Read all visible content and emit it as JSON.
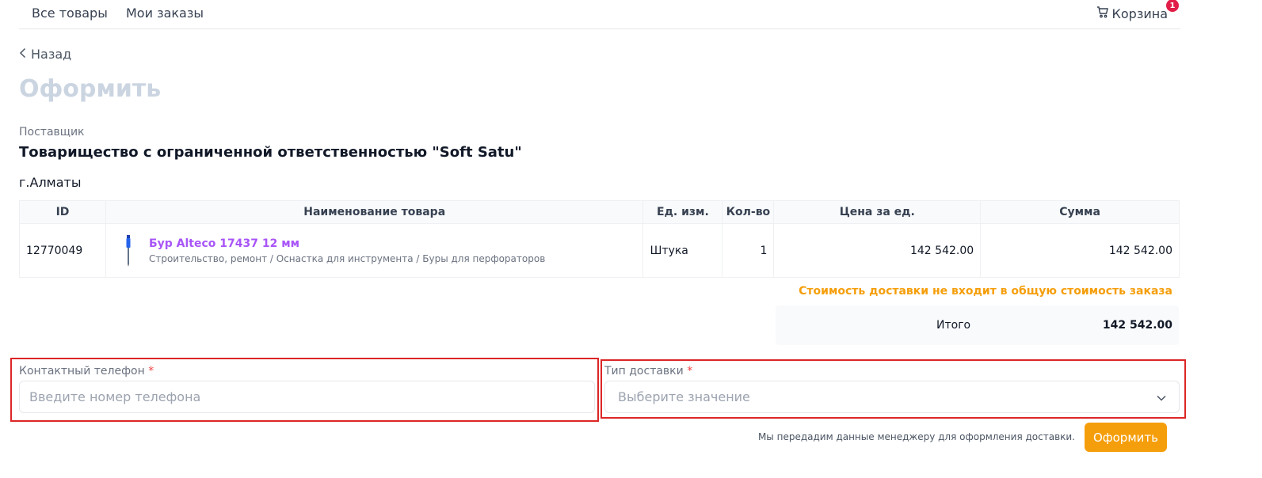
{
  "nav": {
    "all_products": "Все товары",
    "my_orders": "Мои заказы",
    "cart_label": "Корзина",
    "cart_count": "1"
  },
  "back_label": "Назад",
  "page_title": "Оформить",
  "supplier": {
    "label": "Поставщик",
    "name": "Товарищество с ограниченной ответственностью \"Soft Satu\"",
    "city": "г.Алматы"
  },
  "table": {
    "headers": {
      "id": "ID",
      "name": "Наименование товара",
      "unit": "Ед. изм.",
      "qty": "Кол-во",
      "price": "Цена за ед.",
      "sum": "Сумма"
    },
    "rows": [
      {
        "id": "12770049",
        "title": "Бур Alteco 17437 12 мм",
        "path": "Строительство, ремонт / Оснастка для инструмента / Буры для перфораторов",
        "unit": "Штука",
        "qty": "1",
        "price": "142 542.00",
        "sum": "142 542.00"
      }
    ]
  },
  "delivery_note": "Стоимость доставки не входит в общую стоимость заказа",
  "total": {
    "label": "Итого",
    "value": "142 542.00"
  },
  "form": {
    "phone_label": "Контактный телефон",
    "phone_placeholder": "Введите номер телефона",
    "phone_value": "",
    "delivery_label": "Тип доставки",
    "delivery_placeholder": "Выберите значение",
    "required_mark": "*"
  },
  "hint": "Мы передадим данные менеджеру для оформления доставки.",
  "submit_label": "Оформить",
  "colors": {
    "accent": "#f59e0b",
    "product_link": "#a855f7",
    "badge": "#e11d48",
    "frame": "#dc2626"
  }
}
